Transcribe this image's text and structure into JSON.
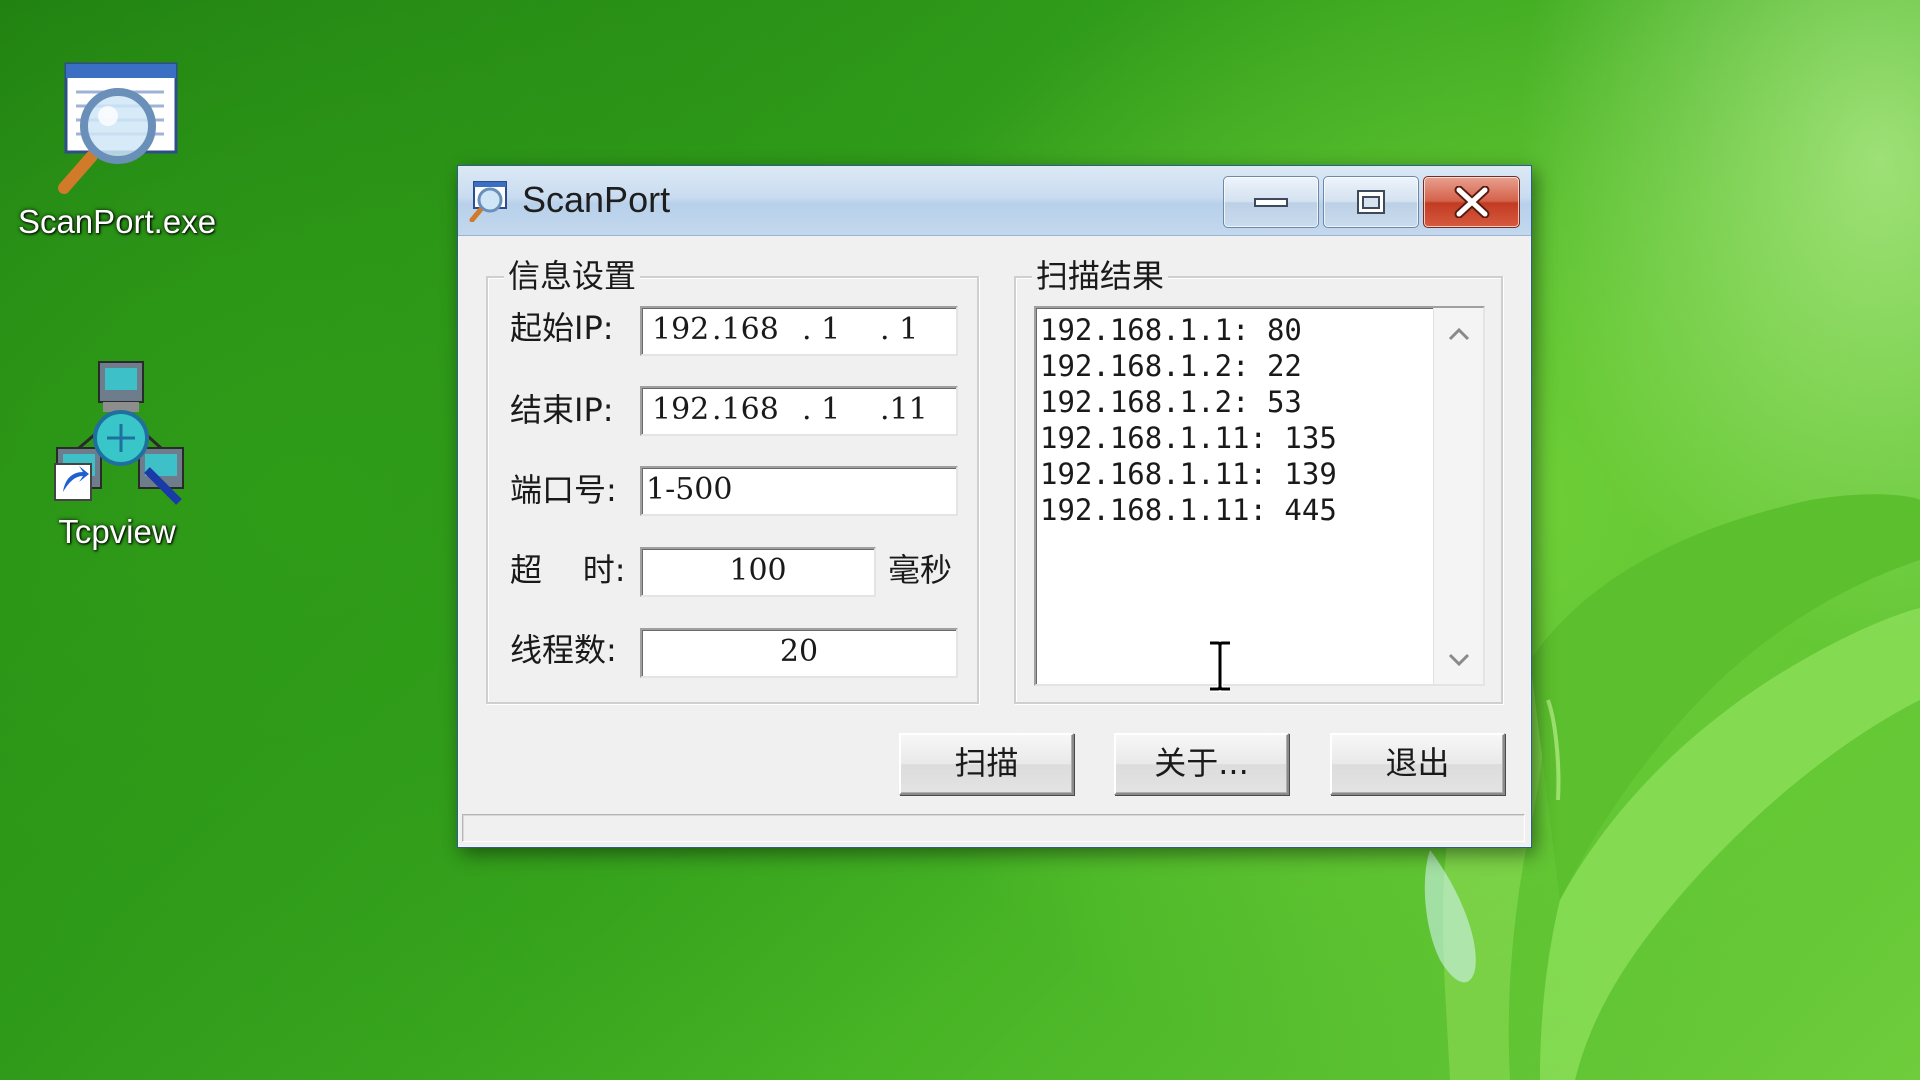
{
  "desktop": {
    "icons": [
      {
        "label": "ScanPort.exe",
        "icon": "magnifier-document-icon"
      },
      {
        "label": "Tcpview",
        "icon": "network-computers-shortcut-icon"
      }
    ]
  },
  "window": {
    "title": "ScanPort",
    "app_icon": "magnifier-app-icon",
    "controls": {
      "minimize": "minimize-icon",
      "maximize": "maximize-icon",
      "close": "close-icon"
    }
  },
  "settings": {
    "group_label": "信息设置",
    "start_ip": {
      "label": "起始IP:",
      "octets": [
        "192",
        ".168",
        ".  1",
        ".  1"
      ]
    },
    "end_ip": {
      "label": "结束IP:",
      "octets": [
        "192",
        ".168",
        ".  1",
        ".11"
      ]
    },
    "port": {
      "label": "端口号:",
      "value": "1-500"
    },
    "timeout": {
      "label": "超    时:",
      "value": "100",
      "unit": "毫秒"
    },
    "threads": {
      "label": "线程数:",
      "value": "20"
    }
  },
  "results": {
    "group_label": "扫描结果",
    "items": [
      "192.168.1.1: 80",
      "192.168.1.2: 22",
      "192.168.1.2: 53",
      "192.168.1.11: 135",
      "192.168.1.11: 139",
      "192.168.1.11: 445"
    ]
  },
  "buttons": {
    "scan": "扫描",
    "about": "关于...",
    "exit": "退出"
  },
  "colors": {
    "close_button": "#c23b22",
    "titlebar": "#c9dcf0",
    "desktop": "#2f9a1a"
  }
}
